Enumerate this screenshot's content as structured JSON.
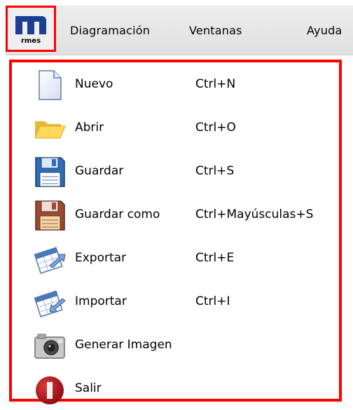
{
  "menubar": {
    "app_logo_text": "rmes",
    "items": [
      {
        "label": "Diagramación"
      },
      {
        "label": "Ventanas"
      },
      {
        "label": "Ayuda"
      }
    ]
  },
  "file_menu": {
    "items": [
      {
        "label": "Nuevo",
        "shortcut": "Ctrl+N",
        "icon": "new-document-icon"
      },
      {
        "label": "Abrir",
        "shortcut": "Ctrl+O",
        "icon": "folder-open-icon"
      },
      {
        "label": "Guardar",
        "shortcut": "Ctrl+S",
        "icon": "floppy-save-icon"
      },
      {
        "label": "Guardar como",
        "shortcut": "Ctrl+Mayúsculas+S",
        "icon": "floppy-save-as-icon"
      },
      {
        "label": "Exportar",
        "shortcut": "Ctrl+E",
        "icon": "export-icon"
      },
      {
        "label": "Importar",
        "shortcut": "Ctrl+I",
        "icon": "import-icon"
      },
      {
        "label": "Generar Imagen",
        "shortcut": "",
        "icon": "camera-icon"
      },
      {
        "label": "Salir",
        "shortcut": "",
        "icon": "exit-icon"
      }
    ]
  },
  "colors": {
    "highlight": "#ff0000",
    "logo_blue": "#1c3f93",
    "menubar_bg": "#e6e6e6"
  }
}
